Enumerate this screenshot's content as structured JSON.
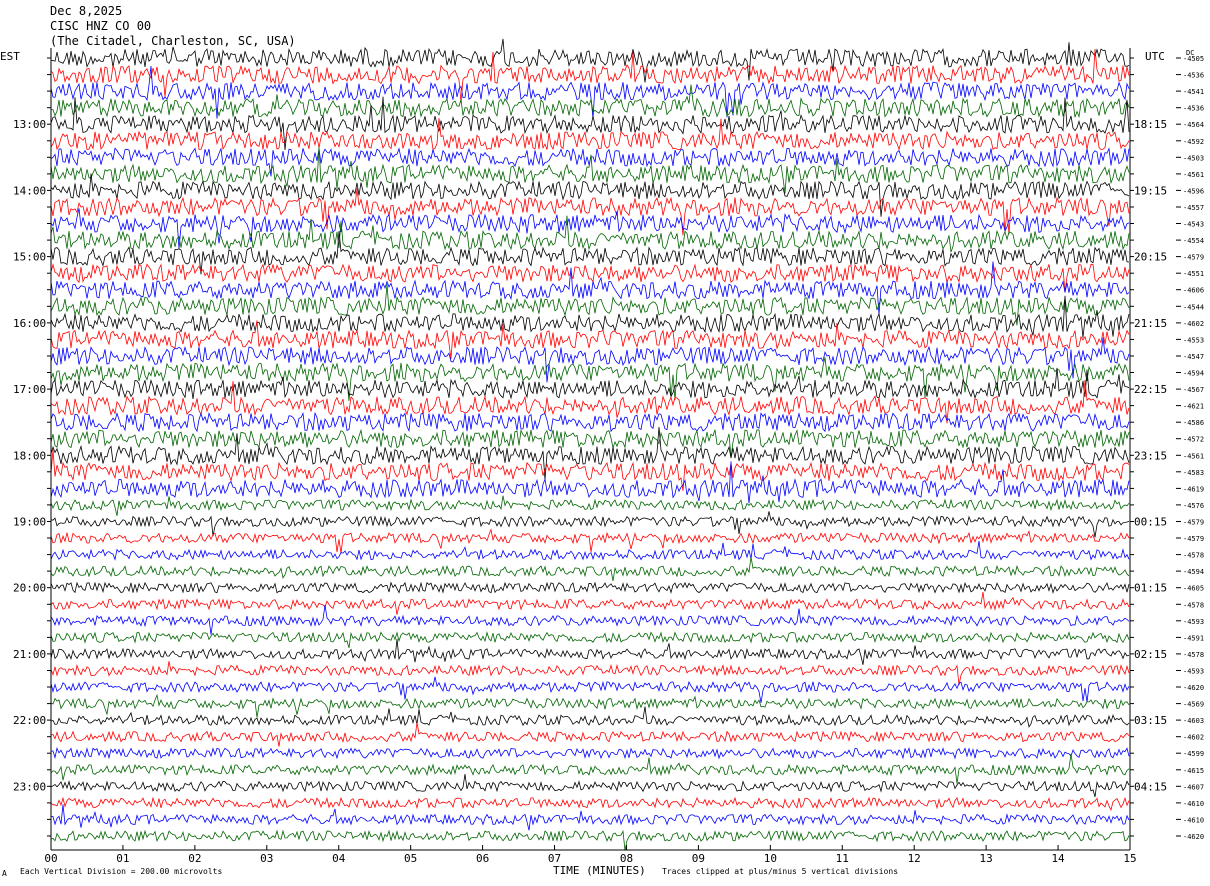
{
  "header": {
    "date": "Dec 8,2025",
    "channel": "CISC HNZ CO 00",
    "station": "(The Citadel, Charleston, SC, USA)"
  },
  "left_tz": "EST",
  "right_tz": "UTC",
  "dc_label": "DC",
  "footer": {
    "scale_note": "Each Vertical Division =  200.00 microvolts",
    "xlabel": "TIME (MINUTES)",
    "clip_note": "Traces clipped at plus/minus 5 vertical divisions",
    "corner_mark": "A"
  },
  "colors": {
    "cycle": [
      "#000000",
      "#ff0000",
      "#0000ff",
      "#006400"
    ]
  },
  "chart_data": {
    "type": "line",
    "subtype": "helicorder",
    "xlim": [
      0,
      15
    ],
    "x_ticks": [
      "00",
      "01",
      "02",
      "03",
      "04",
      "05",
      "06",
      "07",
      "08",
      "09",
      "10",
      "11",
      "12",
      "13",
      "14",
      "15"
    ],
    "trace_count": 48,
    "traces_per_hour": 4,
    "hour_labels_left": [
      "13:00",
      "14:00",
      "15:00",
      "16:00",
      "17:00",
      "18:00",
      "19:00",
      "20:00",
      "21:00",
      "22:00",
      "23:00"
    ],
    "hour_labels_right": [
      "18:15",
      "19:15",
      "20:15",
      "21:15",
      "22:15",
      "23:15",
      "00:15",
      "01:15",
      "02:15",
      "03:15",
      "04:15"
    ],
    "hour_label_first_row": 4,
    "dc_offsets": [
      "-4505",
      "-4536",
      "-4541",
      "-4536",
      "-4564",
      "-4592",
      "-4503",
      "-4561",
      "-4596",
      "-4557",
      "-4543",
      "-4554",
      "-4579",
      "-4551",
      "-4606",
      "-4544",
      "-4602",
      "-4553",
      "-4547",
      "-4594",
      "-4567",
      "-4621",
      "-4586",
      "-4572",
      "-4561",
      "-4583",
      "-4619",
      "-4576",
      "-4579",
      "-4579",
      "-4578",
      "-4594",
      "-4605",
      "-4578",
      "-4593",
      "-4591",
      "-4578",
      "-4593",
      "-4620",
      "-4569",
      "-4603",
      "-4602",
      "-4599",
      "-4615",
      "-4607",
      "-4610",
      "-4610",
      "-4620"
    ]
  }
}
